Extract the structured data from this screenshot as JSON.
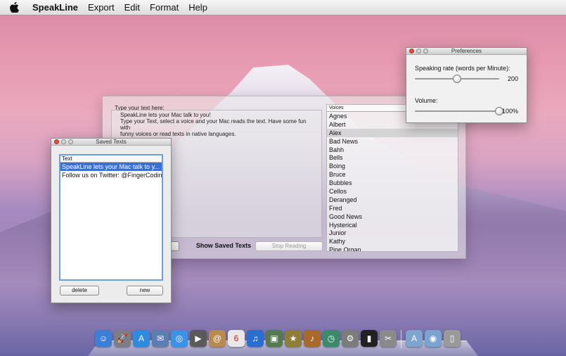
{
  "menubar": {
    "app_name": "SpeakLine",
    "items": [
      "Export",
      "Edit",
      "Format",
      "Help"
    ]
  },
  "main_window": {
    "type_label": "Type your text here:",
    "text_lines": [
      "SpeakLine lets your Mac talk to you!",
      "Type your Text, select a voice and your Mac reads the text. Have some fun with",
      "funny voices or read texts in native languages."
    ],
    "voices_header": "Voices",
    "voices": [
      "Agnes",
      "Albert",
      "Alex",
      "Bad News",
      "Bahh",
      "Bells",
      "Boing",
      "Bruce",
      "Bubbles",
      "Cellos",
      "Deranged",
      "Fred",
      "Good News",
      "Hysterical",
      "Junior",
      "Kathy",
      "Pipe Organ"
    ],
    "selected_voice": "Alex",
    "show_saved_label": "Show Saved Texts",
    "stop_reading_label": "Stop Reading"
  },
  "saved_window": {
    "title": "Saved Texts",
    "column_header": "Text",
    "rows": [
      "SpeakLine lets your Mac talk to y...",
      "Follow us on Twitter: @FingerCoding"
    ],
    "delete_label": "delete",
    "new_label": "new"
  },
  "prefs_window": {
    "title": "Preferences",
    "rate_label": "Speaking rate (words per Minute):",
    "rate_value": "200",
    "rate_fraction": 0.5,
    "volume_label": "Volume:",
    "volume_value": "100%",
    "volume_fraction": 1.0
  },
  "dock": {
    "icons": [
      {
        "name": "finder-icon",
        "glyph": "☺",
        "color": "#3d7fd6"
      },
      {
        "name": "launchpad-icon",
        "glyph": "🚀",
        "color": "#7d7d85"
      },
      {
        "name": "app-store-icon",
        "glyph": "A",
        "color": "#2f8be0"
      },
      {
        "name": "mail-icon",
        "glyph": "✉",
        "color": "#5b7fb0"
      },
      {
        "name": "safari-icon",
        "glyph": "◎",
        "color": "#3b93e6"
      },
      {
        "name": "facetime-icon",
        "glyph": "▶",
        "color": "#5a5a5a"
      },
      {
        "name": "contacts-icon",
        "glyph": "@",
        "color": "#b98a4f"
      },
      {
        "name": "calendar-icon",
        "glyph": "6",
        "color": "#e8e8e8"
      },
      {
        "name": "itunes-icon",
        "glyph": "♫",
        "color": "#2a6fcf"
      },
      {
        "name": "iphoto-icon",
        "glyph": "▣",
        "color": "#557a52"
      },
      {
        "name": "imovie-icon",
        "glyph": "★",
        "color": "#8f7d3a"
      },
      {
        "name": "garageband-icon",
        "glyph": "♪",
        "color": "#a86a2c"
      },
      {
        "name": "time-machine-icon",
        "glyph": "◷",
        "color": "#3b8b6a"
      },
      {
        "name": "system-preferences-icon",
        "glyph": "⚙",
        "color": "#7c7c7c"
      },
      {
        "name": "terminal-icon",
        "glyph": "▮",
        "color": "#222222"
      },
      {
        "name": "utilities-icon",
        "glyph": "✂",
        "color": "#8a8a8a"
      },
      {
        "name": "applications-folder-icon",
        "glyph": "A",
        "color": "#7da5cf"
      },
      {
        "name": "downloads-folder-icon",
        "glyph": "◉",
        "color": "#7aa3d0"
      },
      {
        "name": "trash-icon",
        "glyph": "▯",
        "color": "#9a9a9a"
      }
    ]
  }
}
